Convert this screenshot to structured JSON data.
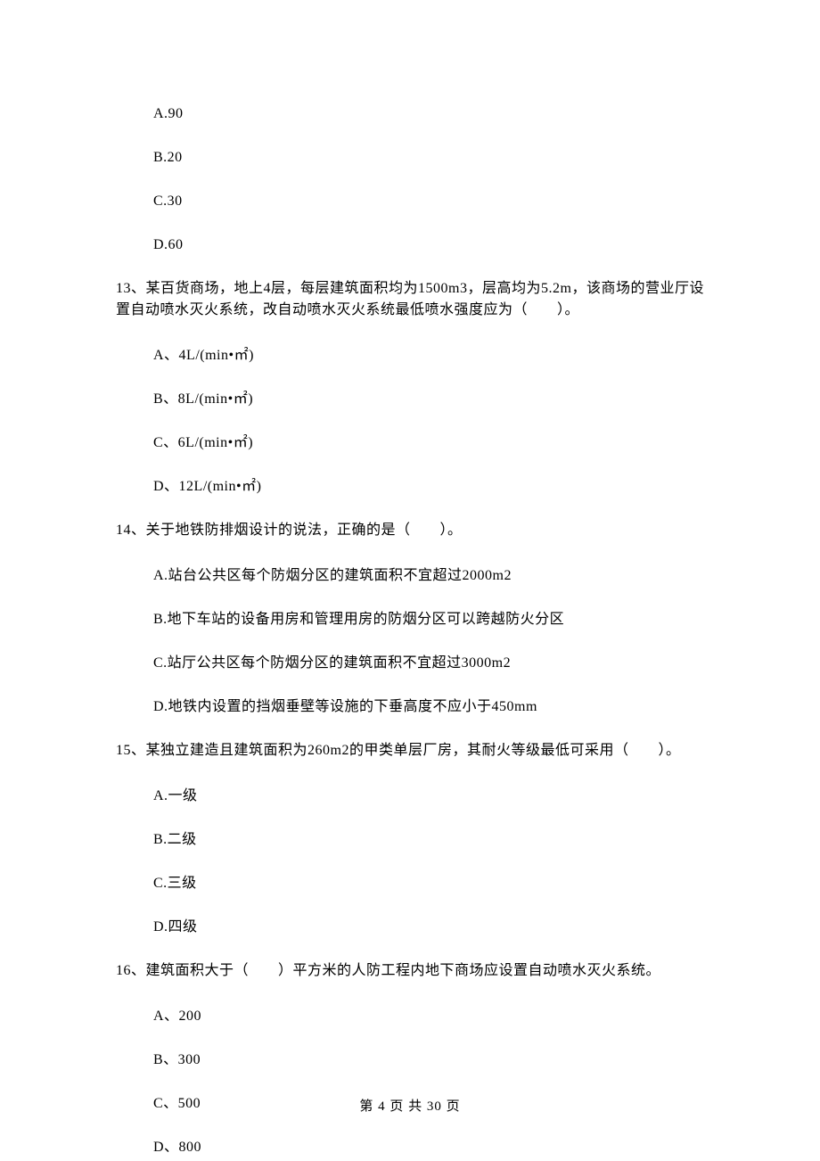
{
  "q12": {
    "options": {
      "a": "A.90",
      "b": "B.20",
      "c": "C.30",
      "d": "D.60"
    }
  },
  "q13": {
    "text": "13、某百货商场，地上4层，每层建筑面积均为1500m3，层高均为5.2m，该商场的营业厅设置自动喷水灭火系统，改自动喷水灭火系统最低喷水强度应为（　　）。",
    "options": {
      "a": "A、4L/(min•㎡)",
      "b": "B、8L/(min•㎡)",
      "c": "C、6L/(min•㎡)",
      "d": "D、12L/(min•㎡)"
    }
  },
  "q14": {
    "text": "14、关于地铁防排烟设计的说法，正确的是（　　）。",
    "options": {
      "a": "A.站台公共区每个防烟分区的建筑面积不宜超过2000m2",
      "b": "B.地下车站的设备用房和管理用房的防烟分区可以跨越防火分区",
      "c": "C.站厅公共区每个防烟分区的建筑面积不宜超过3000m2",
      "d": "D.地铁内设置的挡烟垂壁等设施的下垂高度不应小于450mm"
    }
  },
  "q15": {
    "text": "15、某独立建造且建筑面积为260m2的甲类单层厂房，其耐火等级最低可采用（　　）。",
    "options": {
      "a": "A.一级",
      "b": "B.二级",
      "c": "C.三级",
      "d": "D.四级"
    }
  },
  "q16": {
    "text": "16、建筑面积大于（　　）平方米的人防工程内地下商场应设置自动喷水灭火系统。",
    "options": {
      "a": "A、200",
      "b": "B、300",
      "c": "C、500",
      "d": "D、800"
    }
  },
  "footer": "第 4 页 共 30 页"
}
